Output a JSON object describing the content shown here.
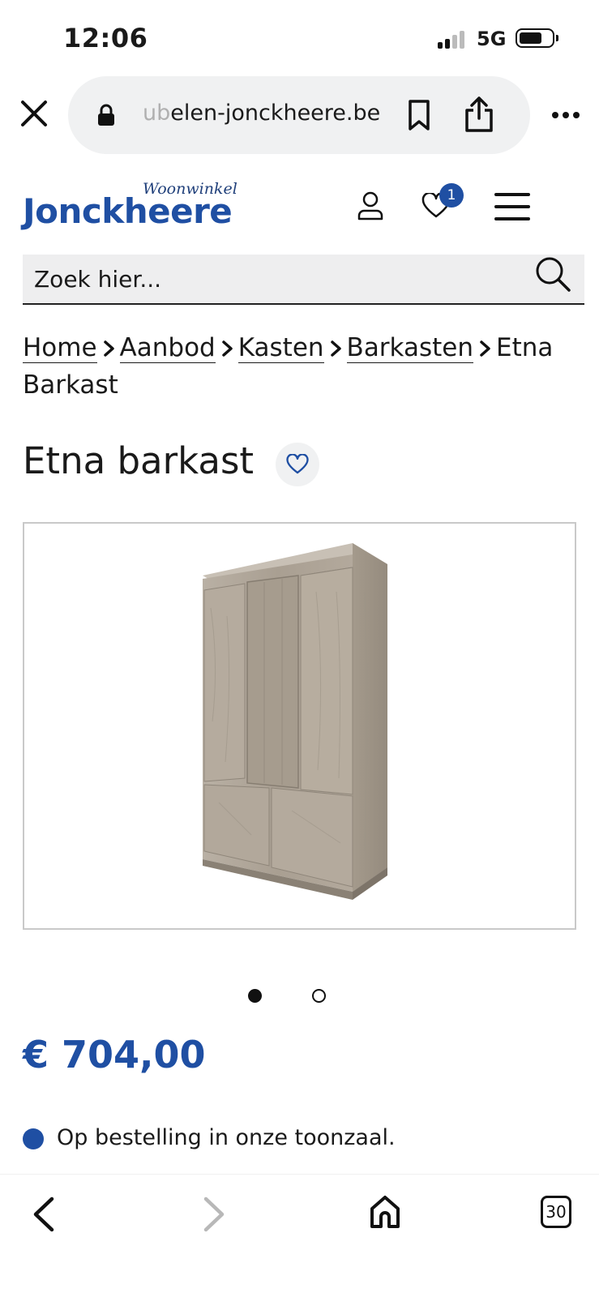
{
  "status_bar": {
    "time": "12:06",
    "network": "5G",
    "icons": [
      "signal-icon",
      "battery-icon"
    ]
  },
  "browser": {
    "url_faded": "ub",
    "url_text": "elen-jonckheere.be",
    "icons": [
      "close-icon",
      "lock-icon",
      "bookmark-icon",
      "share-icon",
      "more-icon"
    ],
    "tab_count": "30"
  },
  "header": {
    "logo_name": "Jonckheere",
    "logo_tagline": "Woonwinkel",
    "wishlist_count": "1",
    "icons": [
      "account-icon",
      "heart-icon",
      "menu-icon"
    ],
    "brand_color": "#1f4fa3"
  },
  "search": {
    "placeholder": "Zoek hier..."
  },
  "breadcrumb": {
    "items": [
      "Home",
      "Aanbod",
      "Kasten",
      "Barkasten"
    ],
    "current": "Etna Barkast"
  },
  "product": {
    "title": "Etna barkast",
    "image_count": 2,
    "active_image": 1,
    "price": "€ 704,00",
    "availability": "Op bestelling in onze toonzaal.",
    "availability_color": "#1f4fa3"
  },
  "bottom_nav": {
    "icons": [
      "back-icon",
      "forward-icon",
      "home-icon",
      "tabs-icon"
    ]
  }
}
